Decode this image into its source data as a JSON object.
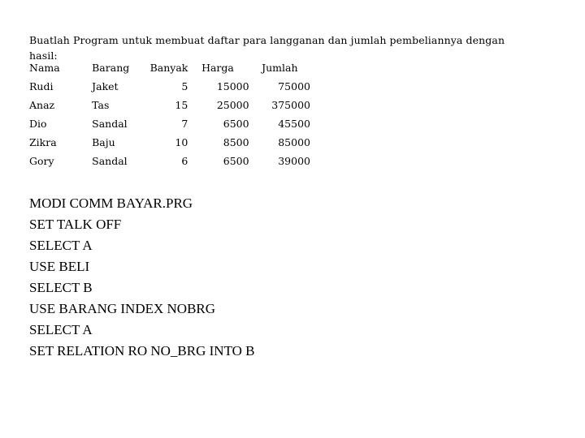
{
  "document": {
    "intro_text": "Buatlah Program untuk membuat daftar para langganan dan jumlah pembeliannya dengan hasil:"
  },
  "table": {
    "headers": {
      "nama": "Nama",
      "barang": "Barang",
      "banyak": "Banyak",
      "harga": "Harga",
      "jumlah": "Jumlah"
    },
    "rows": [
      {
        "nama": "Rudi",
        "barang": "Jaket",
        "banyak": "5",
        "harga": "15000",
        "jumlah": "75000"
      },
      {
        "nama": "Anaz",
        "barang": "Tas",
        "banyak": "15",
        "harga": "25000",
        "jumlah": "375000"
      },
      {
        "nama": "Dio",
        "barang": "Sandal",
        "banyak": "7",
        "harga": "6500",
        "jumlah": "45500"
      },
      {
        "nama": "Zikra",
        "barang": "Baju",
        "banyak": "10",
        "harga": "8500",
        "jumlah": "85000"
      },
      {
        "nama": "Gory",
        "barang": "Sandal",
        "banyak": "6",
        "harga": "6500",
        "jumlah": "39000"
      }
    ]
  },
  "code": {
    "lines": [
      "MODI COMM BAYAR.PRG",
      "SET TALK OFF",
      "SELECT A",
      "USE BELI",
      "SELECT B",
      "USE BARANG INDEX NOBRG",
      "SELECT A",
      "SET RELATION RO NO_BRG INTO B"
    ]
  }
}
